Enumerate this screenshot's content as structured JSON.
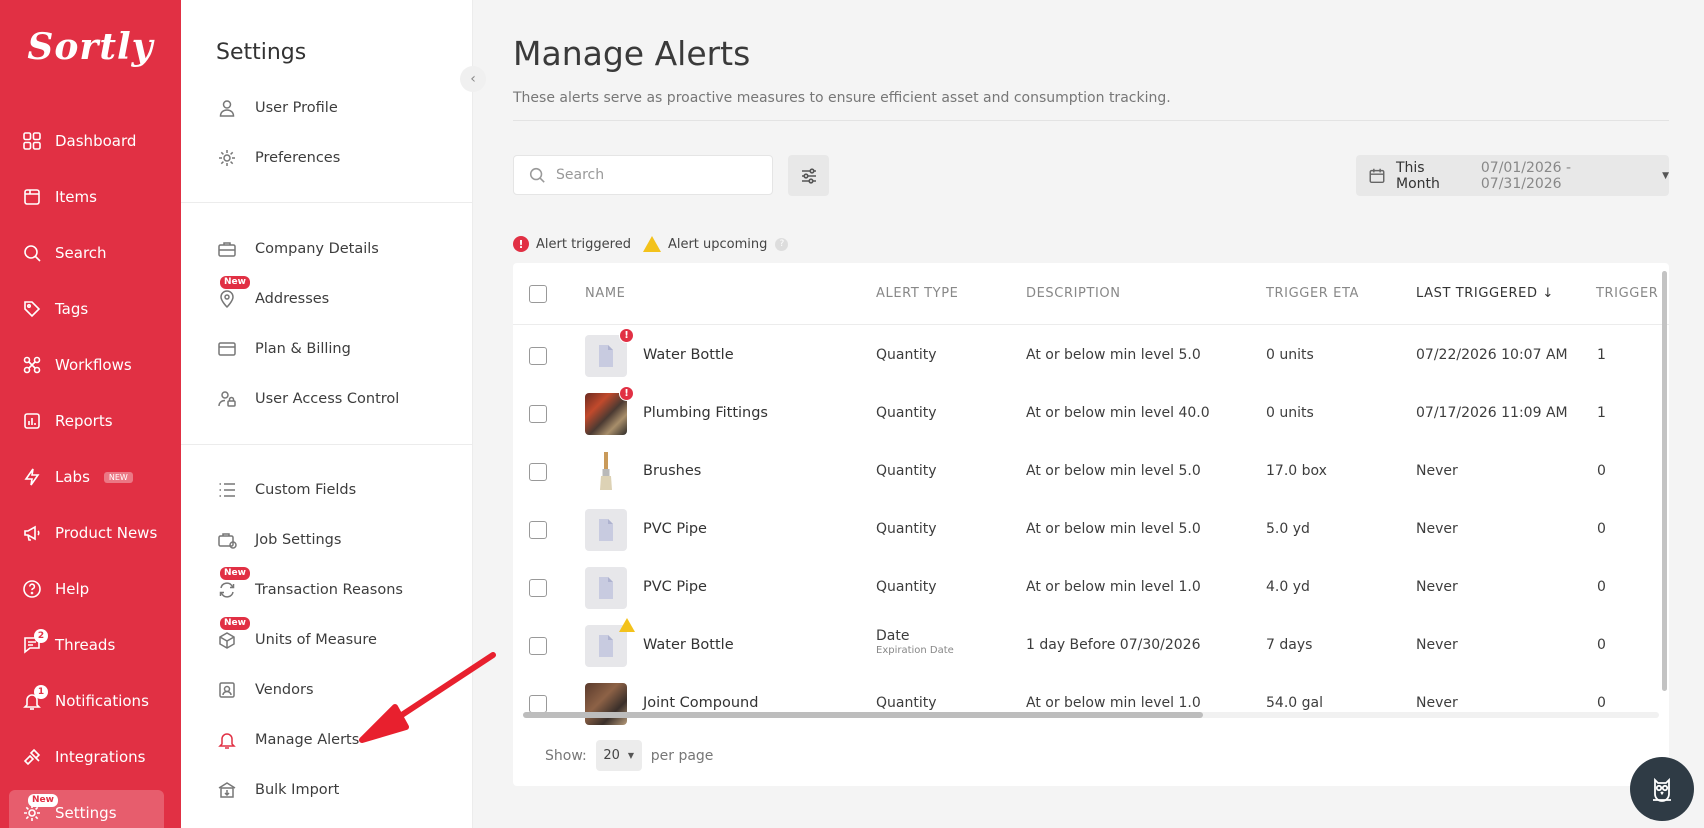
{
  "brand": {
    "logo": "Sortly",
    "color": "#e13044"
  },
  "nav": {
    "items": [
      {
        "label": "Dashboard",
        "icon": "dashboard-icon"
      },
      {
        "label": "Items",
        "icon": "items-icon"
      },
      {
        "label": "Search",
        "icon": "search-icon"
      },
      {
        "label": "Tags",
        "icon": "tag-icon"
      },
      {
        "label": "Workflows",
        "icon": "workflow-icon"
      },
      {
        "label": "Reports",
        "icon": "reports-icon"
      },
      {
        "label": "Labs",
        "icon": "lightning-icon",
        "badge": "NEW"
      },
      {
        "label": "Product News",
        "icon": "megaphone-icon"
      },
      {
        "label": "Help",
        "icon": "help-icon"
      },
      {
        "label": "Threads",
        "icon": "threads-icon",
        "count": "2"
      },
      {
        "label": "Notifications",
        "icon": "bell-icon",
        "count": "1"
      },
      {
        "label": "Integrations",
        "icon": "integrations-icon"
      },
      {
        "label": "Settings",
        "icon": "gear-icon",
        "badge": "New"
      }
    ]
  },
  "settings": {
    "title": "Settings",
    "collapse": "‹",
    "items": [
      {
        "label": "User Profile",
        "icon": "user-icon"
      },
      {
        "label": "Preferences",
        "icon": "gear-icon"
      },
      {
        "label": "Company Details",
        "icon": "briefcase-icon"
      },
      {
        "label": "Addresses",
        "icon": "location-icon",
        "badge": "New"
      },
      {
        "label": "Plan & Billing",
        "icon": "credit-card-icon"
      },
      {
        "label": "User Access Control",
        "icon": "user-lock-icon"
      },
      {
        "label": "Custom Fields",
        "icon": "list-icon"
      },
      {
        "label": "Job Settings",
        "icon": "job-icon"
      },
      {
        "label": "Transaction Reasons",
        "icon": "transaction-icon",
        "badge": "New"
      },
      {
        "label": "Units of Measure",
        "icon": "measure-icon",
        "badge": "New"
      },
      {
        "label": "Vendors",
        "icon": "vendor-icon"
      },
      {
        "label": "Manage Alerts",
        "icon": "alert-bell-icon"
      },
      {
        "label": "Bulk Import",
        "icon": "bulk-import-icon"
      }
    ]
  },
  "main": {
    "title": "Manage Alerts",
    "description": "These alerts serve as proactive measures to ensure efficient asset and consumption tracking.",
    "search_placeholder": "Search",
    "date_filter": {
      "label": "This Month",
      "range": "07/01/2026 - 07/31/2026"
    },
    "legend": {
      "triggered": "Alert triggered",
      "upcoming": "Alert upcoming"
    }
  },
  "table": {
    "columns": [
      "NAME",
      "ALERT TYPE",
      "DESCRIPTION",
      "TRIGGER ETA",
      "LAST TRIGGERED",
      "TRIGGER"
    ],
    "sort_indicator": "↓",
    "rows": [
      {
        "name": "Water Bottle",
        "type": "Quantity",
        "type_sub": "",
        "description": "At or below min level 5.0",
        "eta": "0 units",
        "last": "07/22/2026 10:07 AM",
        "count": "1",
        "status": "triggered",
        "thumb": "placeholder"
      },
      {
        "name": "Plumbing Fittings",
        "type": "Quantity",
        "type_sub": "",
        "description": "At or below min level 40.0",
        "eta": "0 units",
        "last": "07/17/2026 11:09 AM",
        "count": "1",
        "status": "triggered",
        "thumb": "plumb"
      },
      {
        "name": "Brushes",
        "type": "Quantity",
        "type_sub": "",
        "description": "At or below min level 5.0",
        "eta": "17.0 box",
        "last": "Never",
        "count": "0",
        "status": "",
        "thumb": "brush"
      },
      {
        "name": "PVC Pipe",
        "type": "Quantity",
        "type_sub": "",
        "description": "At or below min level 5.0",
        "eta": "5.0 yd",
        "last": "Never",
        "count": "0",
        "status": "",
        "thumb": "placeholder"
      },
      {
        "name": "PVC Pipe",
        "type": "Quantity",
        "type_sub": "",
        "description": "At or below min level 1.0",
        "eta": "4.0 yd",
        "last": "Never",
        "count": "0",
        "status": "",
        "thumb": "placeholder"
      },
      {
        "name": "Water Bottle",
        "type": "Date",
        "type_sub": "Expiration Date",
        "description": "1 day Before 07/30/2026",
        "eta": "7 days",
        "last": "Never",
        "count": "0",
        "status": "upcoming",
        "thumb": "placeholder"
      },
      {
        "name": "Joint Compound",
        "type": "Quantity",
        "type_sub": "",
        "description": "At or below min level 1.0",
        "eta": "54.0 gal",
        "last": "Never",
        "count": "0",
        "status": "",
        "thumb": "joint"
      }
    ]
  },
  "pager": {
    "show_label": "Show:",
    "per_page_value": "20",
    "per_page_label": "per page"
  }
}
